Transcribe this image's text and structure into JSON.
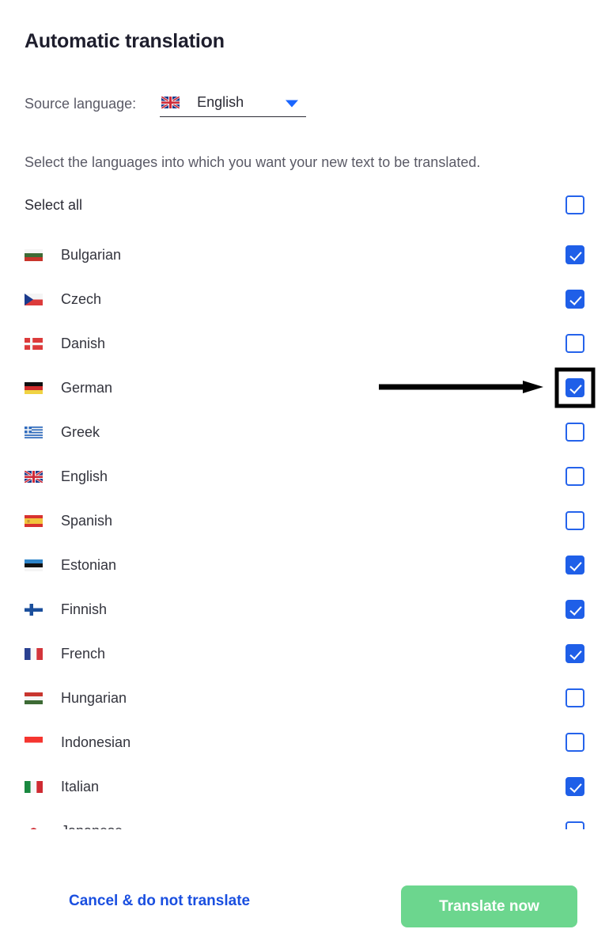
{
  "header": {
    "title": "Automatic translation"
  },
  "source": {
    "label": "Source language:",
    "value": "English",
    "flag": "gb-flag",
    "caret": "chevron-down-icon"
  },
  "description": "Select the languages into which you want your new text to be translated.",
  "select_all": {
    "label": "Select all",
    "checked": false
  },
  "languages": [
    {
      "name": "Bulgarian",
      "flag": "bg-flag",
      "checked": true,
      "highlight": false
    },
    {
      "name": "Czech",
      "flag": "cz-flag",
      "checked": true,
      "highlight": false
    },
    {
      "name": "Danish",
      "flag": "dk-flag",
      "checked": false,
      "highlight": false
    },
    {
      "name": "German",
      "flag": "de-flag",
      "checked": true,
      "highlight": true
    },
    {
      "name": "Greek",
      "flag": "gr-flag",
      "checked": false,
      "highlight": false
    },
    {
      "name": "English",
      "flag": "gb-flag",
      "checked": false,
      "highlight": false
    },
    {
      "name": "Spanish",
      "flag": "es-flag",
      "checked": false,
      "highlight": false
    },
    {
      "name": "Estonian",
      "flag": "ee-flag",
      "checked": true,
      "highlight": false
    },
    {
      "name": "Finnish",
      "flag": "fi-flag",
      "checked": true,
      "highlight": false
    },
    {
      "name": "French",
      "flag": "fr-flag",
      "checked": true,
      "highlight": false
    },
    {
      "name": "Hungarian",
      "flag": "hu-flag",
      "checked": false,
      "highlight": false
    },
    {
      "name": "Indonesian",
      "flag": "id-flag",
      "checked": false,
      "highlight": false
    },
    {
      "name": "Italian",
      "flag": "it-flag",
      "checked": true,
      "highlight": false
    },
    {
      "name": "Japanese",
      "flag": "jp-flag",
      "checked": false,
      "highlight": false
    }
  ],
  "annotation": {
    "arrow": "right-arrow-annotation",
    "points_to": "German"
  },
  "footer": {
    "cancel_label": "Cancel & do not translate",
    "translate_label": "Translate now"
  },
  "colors": {
    "checkbox_blue": "#1f5fe8",
    "link_blue": "#1a4fe0",
    "button_green": "#6cd68e",
    "title_dark": "#1e1e2d",
    "muted_text": "#5a5a66"
  }
}
